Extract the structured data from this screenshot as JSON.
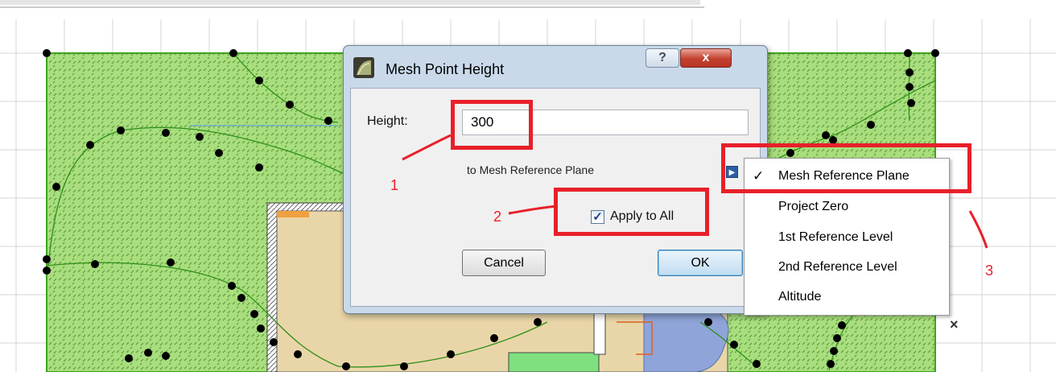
{
  "dialog": {
    "title": "Mesh Point Height",
    "help_label": "?",
    "close_label": "x",
    "height_label": "Height:",
    "height_value": "300",
    "reference_text": "to Mesh Reference Plane",
    "apply_all_label": "Apply to All",
    "apply_all_checked": true,
    "cancel_label": "Cancel",
    "ok_label": "OK"
  },
  "reference_menu": {
    "items": [
      {
        "label": "Mesh Reference Plane",
        "checked": true
      },
      {
        "label": "Project Zero",
        "checked": false
      },
      {
        "label": "1st Reference Level",
        "checked": false
      },
      {
        "label": "2nd Reference Level",
        "checked": false
      },
      {
        "label": "Altitude",
        "checked": false
      }
    ],
    "check_glyph": "✓"
  },
  "annotations": {
    "step1": "1",
    "step2": "2",
    "step3": "3",
    "color": "#e8202a"
  },
  "canvas": {
    "close_glyph": "×",
    "mesh_fill_color": "#9fdc72",
    "building_color": "#e9d6a8",
    "pool_color": "#8fa4d8"
  }
}
